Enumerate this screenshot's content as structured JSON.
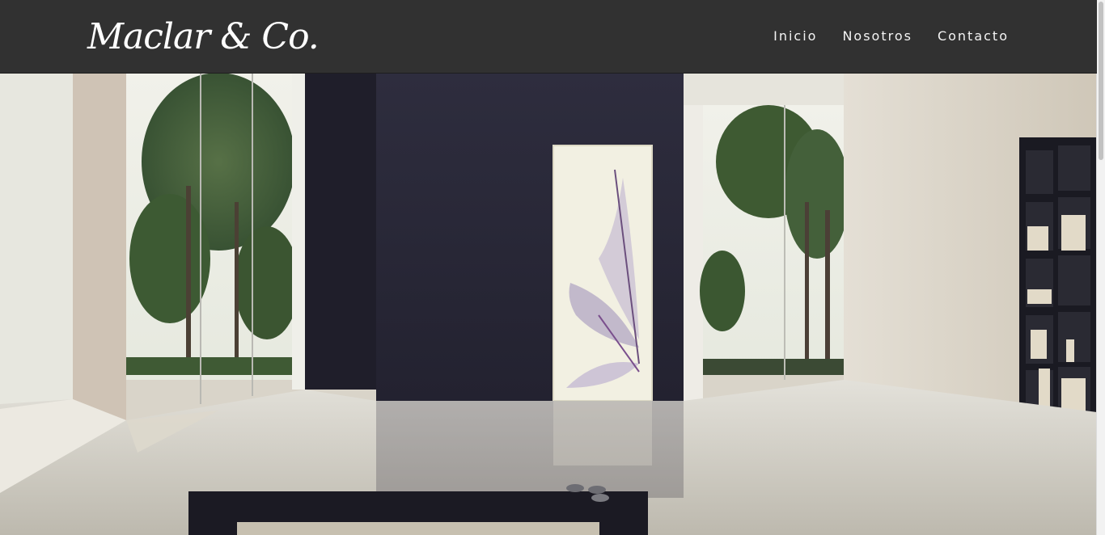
{
  "header": {
    "logo_text": "Maclar & Co.",
    "nav": [
      {
        "label": "Inicio"
      },
      {
        "label": "Nosotros"
      },
      {
        "label": "Contacto"
      }
    ]
  },
  "colors": {
    "header_bg": "#313131",
    "nav_text": "#f4f4f4",
    "accent_wall": "#2b2a3a"
  },
  "hero": {
    "image": "interior-living-room-photo"
  }
}
